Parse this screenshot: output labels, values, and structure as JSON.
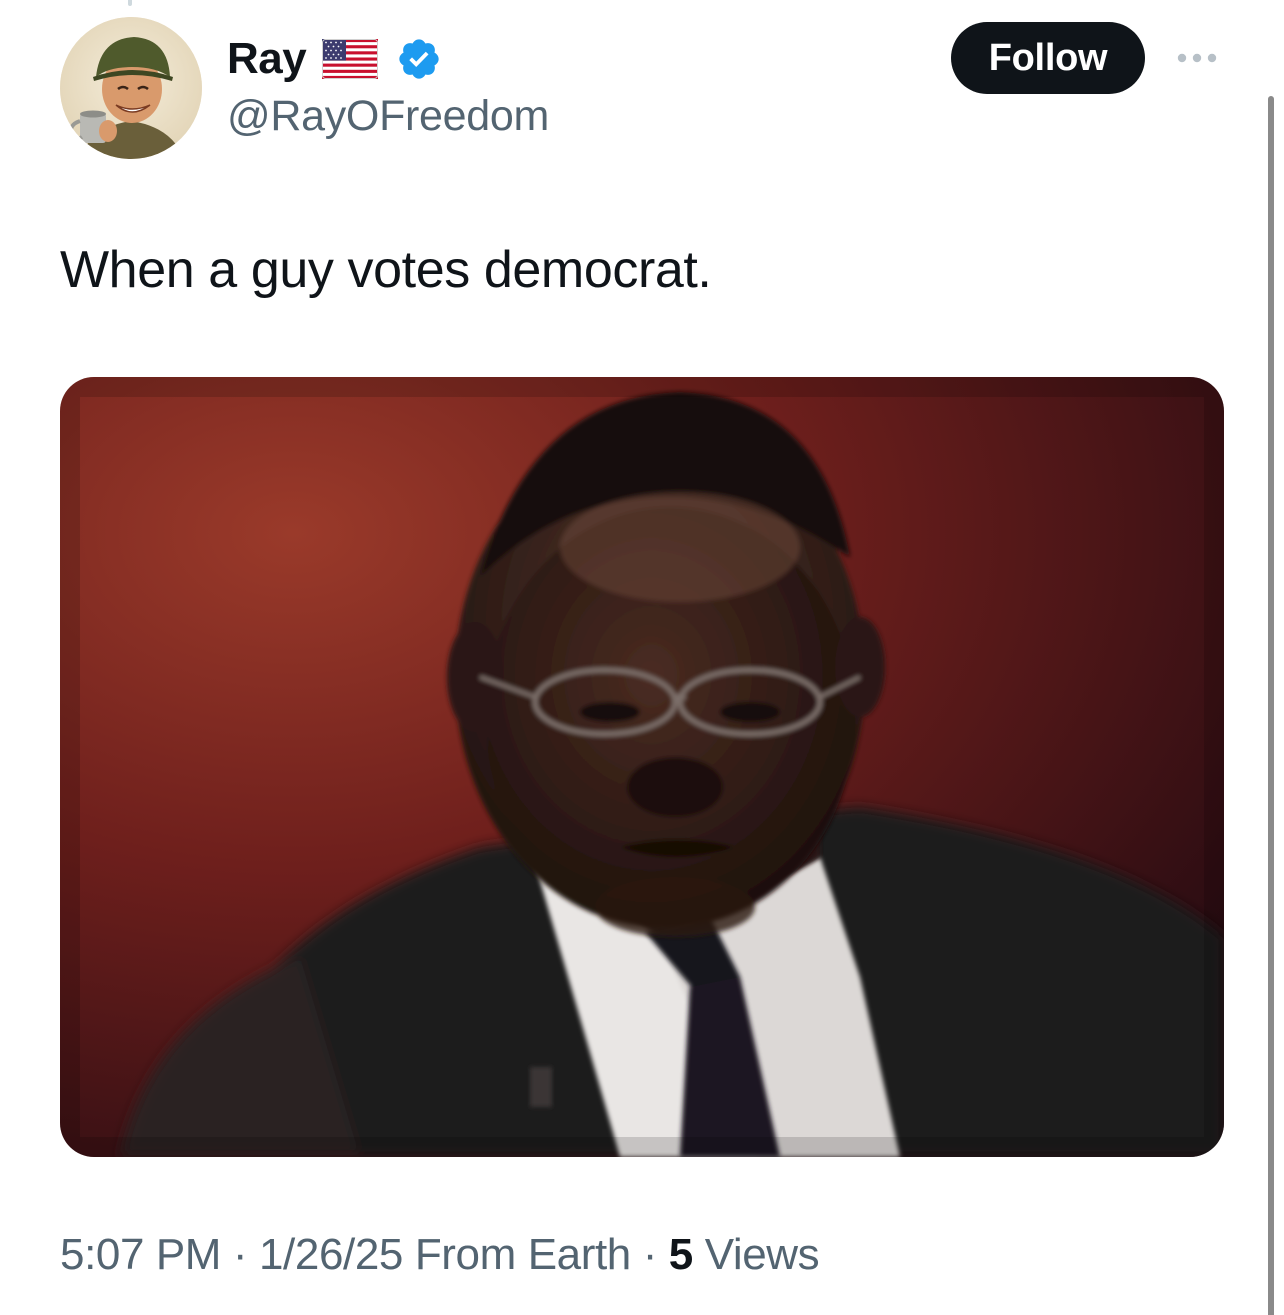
{
  "author": {
    "display_name": "Ray",
    "handle": "@RayOFreedom",
    "flag_icon": "us-flag-icon",
    "verified_icon": "verified-badge-icon",
    "verified_color": "#1d9bf0"
  },
  "actions": {
    "follow_label": "Follow",
    "more_icon": "more-options-icon"
  },
  "tweet": {
    "text": "When a guy votes democrat."
  },
  "meta": {
    "time": "5:07 PM",
    "separator": "·",
    "date": "1/26/25",
    "source": "From Earth",
    "views_count": "5",
    "views_label": "Views"
  },
  "colors": {
    "text_primary": "#0f1419",
    "text_secondary": "#536471",
    "follow_bg": "#0f1419"
  }
}
